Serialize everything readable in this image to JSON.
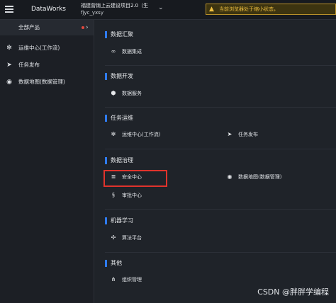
{
  "topbar": {
    "brand": "DataWorks",
    "project_line1": "福建营销上云建设项目2.0（生",
    "project_line2": "fjyc_yxsy",
    "warning": "当前浏览器处于缩小状态，"
  },
  "sidebar": {
    "all_products": "全部产品",
    "items": [
      {
        "label": "运维中心(工作流)",
        "icon": "gear-icon"
      },
      {
        "label": "任务发布",
        "icon": "send-icon"
      },
      {
        "label": "数据地图(数据管理)",
        "icon": "map-icon"
      }
    ]
  },
  "main": {
    "sections": [
      {
        "title": "数据汇聚",
        "items": [
          {
            "label": "数据集成",
            "icon": "integration-icon"
          }
        ]
      },
      {
        "title": "数据开发",
        "items": [
          {
            "label": "数据服务",
            "icon": "service-icon"
          }
        ]
      },
      {
        "title": "任务运维",
        "items": [
          {
            "label": "运维中心(工作流)",
            "icon": "gear-icon"
          },
          {
            "label": "任务发布",
            "icon": "send-icon"
          }
        ]
      },
      {
        "title": "数据治理",
        "items": [
          {
            "label": "安全中心",
            "icon": "security-icon"
          },
          {
            "label": "数据地图(数据管理)",
            "icon": "map-icon"
          },
          {
            "label": "审批中心",
            "icon": "approval-icon"
          }
        ]
      },
      {
        "title": "机器学习",
        "items": [
          {
            "label": "算法平台",
            "icon": "algorithm-icon"
          }
        ]
      },
      {
        "title": "其他",
        "items": [
          {
            "label": "组织管理",
            "icon": "organization-icon"
          }
        ]
      }
    ]
  },
  "watermark": "CSDN @胖胖学编程",
  "colors": {
    "accent": "#2f7bf0",
    "highlight": "#e0332c",
    "warning": "#f0c040"
  }
}
